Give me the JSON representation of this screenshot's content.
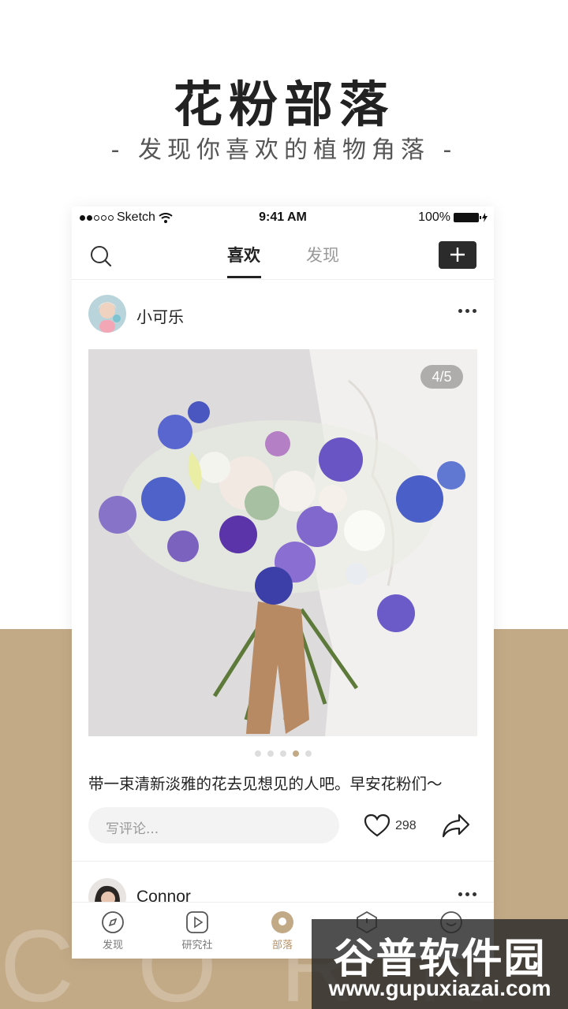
{
  "promo": {
    "title": "花粉部落",
    "subtitle": "- 发现你喜欢的植物角落 -",
    "background_text": "CORN",
    "accent_color": "#c3aa87"
  },
  "statusbar": {
    "carrier": "Sketch",
    "time": "9:41 AM",
    "battery": "100%"
  },
  "navbar": {
    "tabs": [
      {
        "label": "喜欢",
        "active": true
      },
      {
        "label": "发现",
        "active": false
      }
    ],
    "search_icon": "search-icon",
    "add_icon": "plus-icon"
  },
  "post": {
    "username": "小可乐",
    "image_counter": "4/5",
    "image_description": "bouquet of purple and white flowers",
    "pager": {
      "count": 5,
      "active_index": 3
    },
    "caption": "带一束清新淡雅的花去见想见的人吧。早安花粉们～",
    "comment_placeholder": "写评论...",
    "like_count": "298"
  },
  "post2": {
    "username": "Connor"
  },
  "tabbar": {
    "items": [
      {
        "label": "发现",
        "icon": "compass-icon",
        "active": false
      },
      {
        "label": "研究社",
        "icon": "play-icon",
        "active": false
      },
      {
        "label": "部落",
        "icon": "tribe-icon",
        "active": true
      },
      {
        "label": "",
        "icon": "alert-icon",
        "active": false
      },
      {
        "label": "",
        "icon": "smile-icon",
        "active": false
      }
    ]
  },
  "watermark": {
    "name": "谷普软件园",
    "url": "www.gupuxiazai.com"
  }
}
